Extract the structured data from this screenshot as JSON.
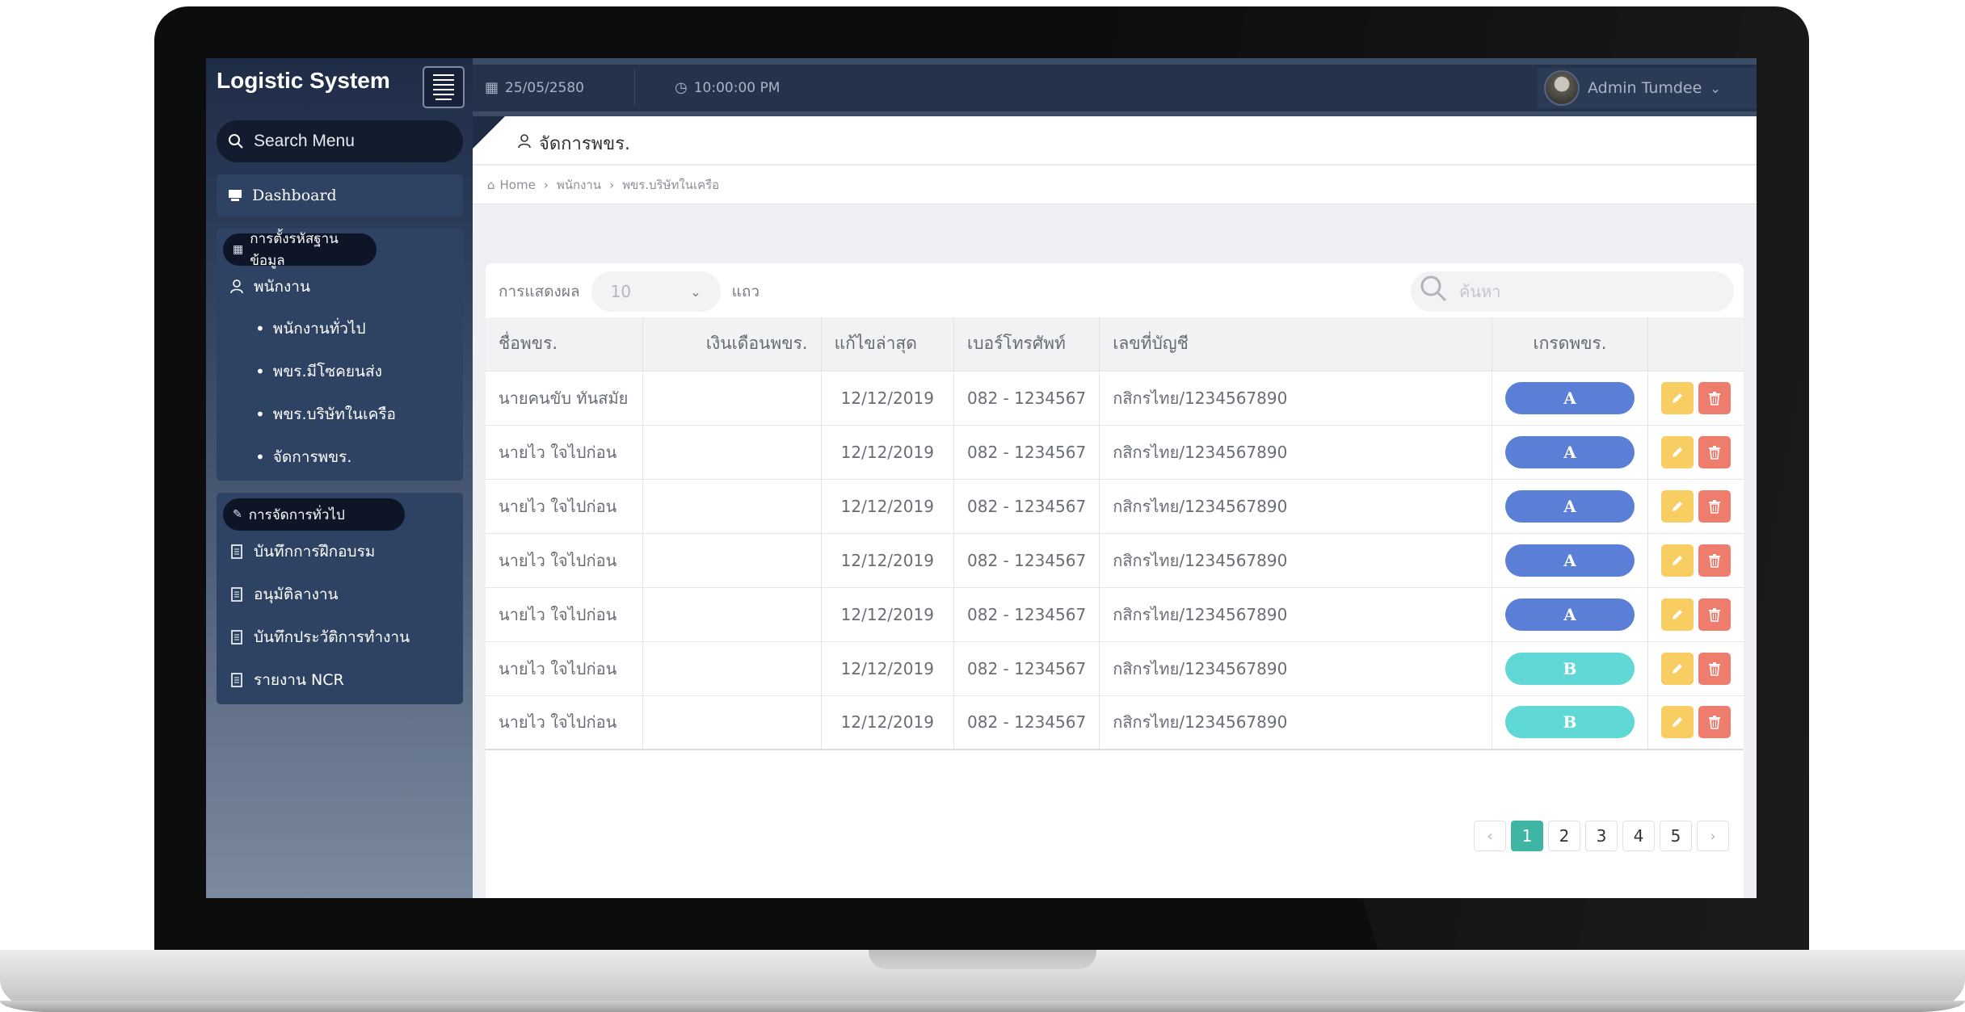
{
  "sidebar": {
    "brand": "Logistic System",
    "search_placeholder": "Search Menu",
    "dashboard_label": "Dashboard",
    "group1": {
      "title": "การตั้งรหัสฐานข้อมูล",
      "section_label": "พนักงาน",
      "items": [
        "พนักงานทั่วไป",
        "พขร.มีโซคยนส่ง",
        "พขร.บริษัทในเครือ",
        "จัดการพขร."
      ]
    },
    "group2": {
      "title": "การจัดการทั่วไป",
      "items": [
        "บันทึกการฝึกอบรม",
        "อนุมัติลางาน",
        "บันทึกประวัติการทำงาน",
        "รายงาน NCR"
      ]
    }
  },
  "topbar": {
    "date": "25/05/2580",
    "time": "10:00:00 PM",
    "user": "Admin Tumdee"
  },
  "page": {
    "title": "จัดการพขร.",
    "breadcrumb": [
      "Home",
      "พนักงาน",
      "พขร.บริษัทในเครือ"
    ]
  },
  "table_tools": {
    "show_label": "การแสดงผล",
    "length_value": "10",
    "rows_label": "แถว",
    "search_placeholder": "ค้นหา"
  },
  "table": {
    "columns": [
      "ชื่อพขร.",
      "เงินเดือนพขร.",
      "แก้ไขล่าสุด",
      "เบอร์โทรศัพท์",
      "เลขที่บัญชี",
      "เกรดพขร.",
      ""
    ],
    "rows": [
      {
        "name": "นายคนขับ ทันสมัย",
        "salary": "",
        "date": "12/12/2019",
        "phone": "082 - 1234567",
        "account": "กสิกรไทย/1234567890",
        "grade": "A"
      },
      {
        "name": "นายไว ใจไปก่อน",
        "salary": "",
        "date": "12/12/2019",
        "phone": "082 - 1234567",
        "account": "กสิกรไทย/1234567890",
        "grade": "A"
      },
      {
        "name": "นายไว ใจไปก่อน",
        "salary": "",
        "date": "12/12/2019",
        "phone": "082 - 1234567",
        "account": "กสิกรไทย/1234567890",
        "grade": "A"
      },
      {
        "name": "นายไว ใจไปก่อน",
        "salary": "",
        "date": "12/12/2019",
        "phone": "082 - 1234567",
        "account": "กสิกรไทย/1234567890",
        "grade": "A"
      },
      {
        "name": "นายไว ใจไปก่อน",
        "salary": "",
        "date": "12/12/2019",
        "phone": "082 - 1234567",
        "account": "กสิกรไทย/1234567890",
        "grade": "A"
      },
      {
        "name": "นายไว ใจไปก่อน",
        "salary": "",
        "date": "12/12/2019",
        "phone": "082 - 1234567",
        "account": "กสิกรไทย/1234567890",
        "grade": "B"
      },
      {
        "name": "นายไว ใจไปก่อน",
        "salary": "",
        "date": "12/12/2019",
        "phone": "082 - 1234567",
        "account": "กสิกรไทย/1234567890",
        "grade": "B"
      }
    ]
  },
  "pagination": {
    "prev": "‹",
    "next": "›",
    "pages": [
      "1",
      "2",
      "3",
      "4",
      "5"
    ],
    "active": "1"
  },
  "colors": {
    "grade_A": "#5b7ed6",
    "grade_B": "#5fd8d6",
    "edit": "#f8cd62",
    "delete": "#ee7d6e",
    "page_active": "#3fb5a4"
  },
  "icons": {
    "menu": "menu-icon",
    "search": "search-icon",
    "dashboard": "dashboard-icon",
    "user": "user-icon",
    "document": "document-icon",
    "calendar": "calendar-icon",
    "clock": "clock-icon",
    "home": "home-icon",
    "edit": "pencil-icon",
    "delete": "trash-icon"
  }
}
